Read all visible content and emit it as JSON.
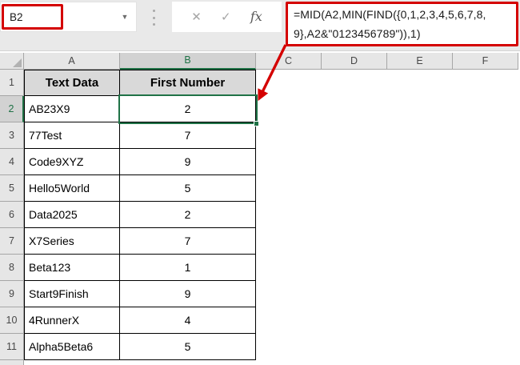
{
  "chrome": {
    "name_box": "B2",
    "dropdown_icon": "▼",
    "cancel_icon": "✕",
    "enter_icon": "✓",
    "fx_label": "fx",
    "formula": "=MID(A2,MIN(FIND({0,1,2,3,4,5,6,7,8,9},A2&\"0123456789\")),1)",
    "formula_lines": [
      "=MID(A2,MIN(FIND({0,1,2,3,4,5,6,7,8,",
      "9},A2&\"0123456789\")),1)"
    ]
  },
  "sheet": {
    "selected_cell": "B2",
    "column_headers": [
      "A",
      "B",
      "C",
      "D",
      "E",
      "F"
    ],
    "selected_column": "B",
    "selected_row": "2",
    "rows": [
      {
        "num": "1",
        "a": "Text Data",
        "b": "First Number"
      },
      {
        "num": "2",
        "a": "AB23X9",
        "b": "2"
      },
      {
        "num": "3",
        "a": "77Test",
        "b": "7"
      },
      {
        "num": "4",
        "a": "Code9XYZ",
        "b": "9"
      },
      {
        "num": "5",
        "a": "Hello5World",
        "b": "5"
      },
      {
        "num": "6",
        "a": "Data2025",
        "b": "2"
      },
      {
        "num": "7",
        "a": "X7Series",
        "b": "7"
      },
      {
        "num": "8",
        "a": "Beta123",
        "b": "1"
      },
      {
        "num": "9",
        "a": "Start9Finish",
        "b": "9"
      },
      {
        "num": "10",
        "a": "4RunnerX",
        "b": "4"
      },
      {
        "num": "11",
        "a": "Alpha5Beta6",
        "b": "5"
      }
    ]
  },
  "colors": {
    "annotation_red": "#d40000",
    "selection_green": "#1f7246",
    "column_header_gray": "#e6e6e6",
    "selected_header_gray": "#d2d2d2",
    "table_header_fill": "#d9d9d9"
  }
}
